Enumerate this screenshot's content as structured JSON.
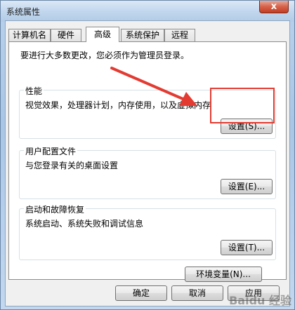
{
  "window": {
    "title": "系统属性",
    "close_glyph": "x"
  },
  "tabs": [
    {
      "label": "计算机名",
      "active": false
    },
    {
      "label": "硬件",
      "active": false
    },
    {
      "label": "高级",
      "active": true
    },
    {
      "label": "系统保护",
      "active": false
    },
    {
      "label": "远程",
      "active": false
    }
  ],
  "panel": {
    "admin_note": "要进行大多数更改，您必须作为管理员登录。",
    "performance": {
      "title": "性能",
      "description": "视觉效果，处理器计划，内存使用，以及虚拟内存",
      "settings_label": "设置(S)..."
    },
    "user_profiles": {
      "title": "用户配置文件",
      "description": "与您登录有关的桌面设置",
      "settings_label": "设置(E)..."
    },
    "startup_recovery": {
      "title": "启动和故障恢复",
      "description": "系统启动、系统失败和调试信息",
      "settings_label": "设置(T)..."
    },
    "env_vars_label": "环境变量(N)..."
  },
  "footer": {
    "ok_label": "确定",
    "cancel_label": "取消",
    "apply_label": "应用"
  },
  "watermark": "Baidu 经验",
  "colors": {
    "highlight": "#e33b32",
    "arrow": "#e33b32"
  }
}
